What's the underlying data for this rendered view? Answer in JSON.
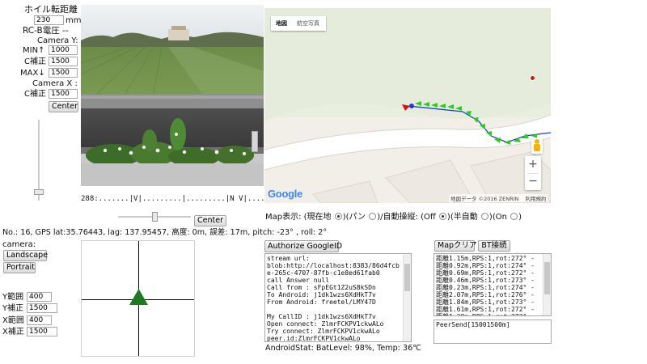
{
  "controls": {
    "wheel_distance_label": "ホイル転距離",
    "wheel_distance_value": "230",
    "wheel_distance_unit": "mm",
    "rcb_voltage_label": "RC-B電圧 --",
    "camera_y_label": "Camera Y:",
    "min_label": "MIN↑",
    "min_value": "1000",
    "c_correction_label": "C補正",
    "c_correction_y_value": "1500",
    "max_label": "MAX↓",
    "max_value": "1500",
    "camera_x_label": "Camera X :",
    "c_correction_x_value": "1500",
    "center_button": "Center"
  },
  "camera_view": {
    "ruler_text": "288:.......|V|.........|.........|N V|........|...",
    "center_button": "Center"
  },
  "map": {
    "tab_map": "地図",
    "tab_aerial": "航空写真",
    "logo": "Google",
    "attribution": "地図データ ©2016 ZENRIN",
    "terms": "利用規約",
    "zoom_in": "+",
    "zoom_out": "−"
  },
  "map_mode": {
    "label": "Map表示: (現在地",
    "pan": ")(パン",
    "auto_steer": ")/自動操縦: (Off",
    "semi_auto": ")(半自動",
    "on": ")(On",
    "close": ")"
  },
  "status_line": "No.: 16, GPS lat:35.76443, lag: 137.95457, 高度: 0m, 誤差: 17m, pitch: -23° , roll: 2°",
  "camera_section": {
    "label": "camera:",
    "landscape_button": "Landscape",
    "portrait_button": "Portrait"
  },
  "ranges": {
    "y_range_label": "Y範囲",
    "y_range_value": "400",
    "y_corr_label": "Y補正",
    "y_corr_value": "1500",
    "x_range_label": "X範囲",
    "x_range_value": "400",
    "x_corr_label": "X補正",
    "x_corr_value": "1500"
  },
  "google": {
    "authorize_button": "Authorize GoogleID",
    "log_lines": [
      "stream url:",
      "blob:http://localhost:8383/86d4fcb",
      "e-265c-4707-87fb-c1e8ed61fab0",
      "call Answer null",
      "Call from : sFpEGt1Z2uS8kSDn",
      "To Android: j1dk1wzs6XdHkT7v",
      "From Android: freetel/LMY47D",
      "",
      "My CallID : j1dk1wzs6XdHkT7v",
      "Open  connect: ZlmrFCKPV1ckwALo",
      "Try connect: ZlmrFCKPV1ckwALo",
      "peer.id:ZlmrFCKPV1ckwALo"
    ],
    "android_stat": "AndroidStat:   BatLevel: 98%, Temp: 36℃"
  },
  "right_panel": {
    "map_clear_button": "Mapクリア",
    "bt_connect_button": "BT接続",
    "distance_lines": [
      "距離1.15m,RPS:1,rot:272° -",
      "距離0.92m,RPS:1,rot:274° -",
      "距離0.69m,RPS:1,rot:272° -",
      "距離0.46m,RPS:1,rot:273° -",
      "距離0.23m,RPS:1,rot:274° -",
      "距離2.07m,RPS:1,rot:276° -",
      "距離1.84m,RPS:1,rot:273° -",
      "距離1.61m,RPS:1,rot:272° -",
      "距離1.38m,RPS:1,rot:273° -"
    ],
    "peer_send": "PeerSend[15001500m]"
  },
  "colors": {
    "route": "#2ecc1a",
    "marker_red": "#e01010",
    "marker_blue": "#1a3fcf",
    "joystick_triangle": "#1e7a1e"
  }
}
